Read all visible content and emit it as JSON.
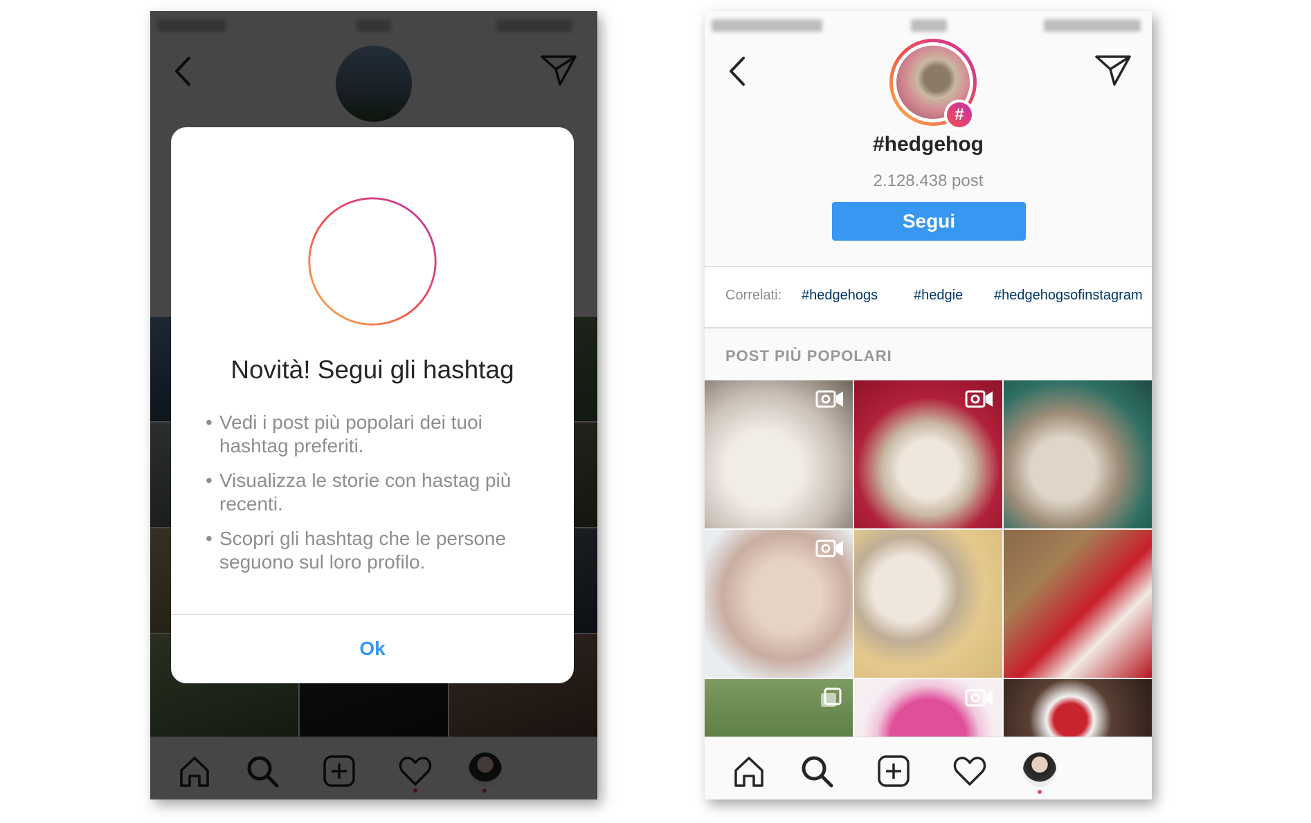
{
  "left": {
    "modal": {
      "title": "Novità! Segui gli hashtag",
      "bullets": [
        "Vedi i post più popolari dei tuoi hashtag preferiti.",
        "Visualizza le storie con hastag più recenti.",
        "Scopri gli hashtag che le persone seguono sul loro profilo."
      ],
      "ok_label": "Ok"
    }
  },
  "right": {
    "hashtag": "#hedgehog",
    "post_count": "2.128.438 post",
    "follow_label": "Segui",
    "related": {
      "label": "Correlati:",
      "tags": [
        "#hedgehogs",
        "#hedgie",
        "#hedgehogsofinstagram"
      ]
    },
    "section_title": "POST PIÙ POPOLARI",
    "tiles": [
      {
        "badge": "video-icon"
      },
      {
        "badge": "video-icon"
      },
      {
        "badge": ""
      },
      {
        "badge": "video-icon"
      },
      {
        "badge": ""
      },
      {
        "badge": ""
      },
      {
        "badge": "carousel-icon"
      },
      {
        "badge": "video-icon"
      },
      {
        "badge": ""
      }
    ]
  },
  "colors": {
    "accent": "#3897f0",
    "hashtag_link": "#003569",
    "notification_dot": "#ed4956"
  }
}
